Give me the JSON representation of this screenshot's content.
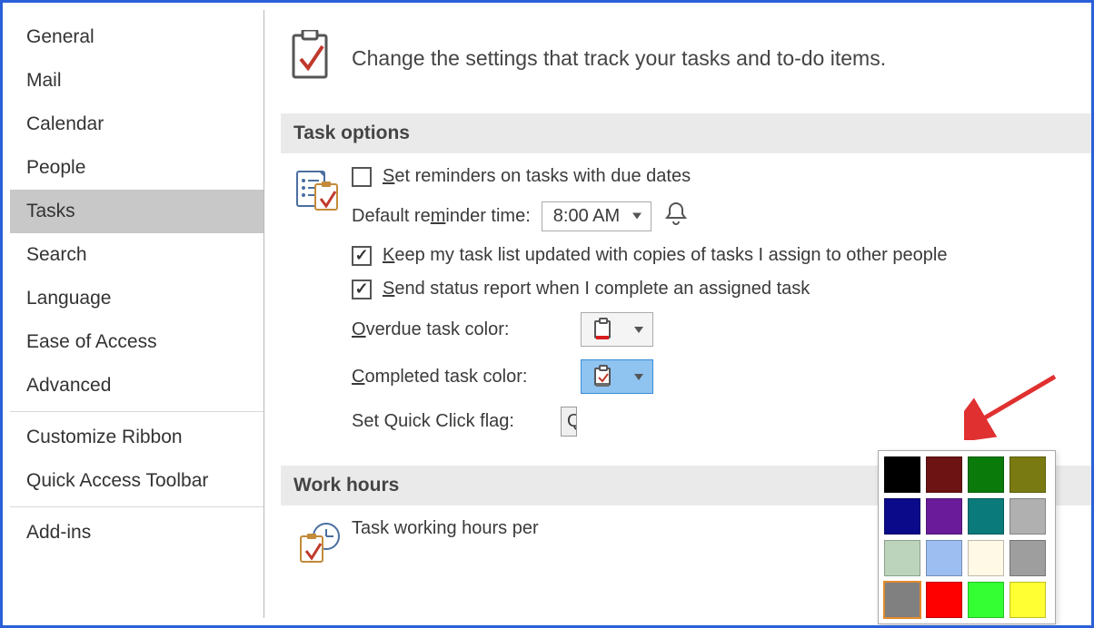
{
  "sidebar": {
    "items": [
      {
        "label": "General"
      },
      {
        "label": "Mail"
      },
      {
        "label": "Calendar"
      },
      {
        "label": "People"
      },
      {
        "label": "Tasks"
      },
      {
        "label": "Search"
      },
      {
        "label": "Language"
      },
      {
        "label": "Ease of Access"
      },
      {
        "label": "Advanced"
      },
      {
        "label": "Customize Ribbon"
      },
      {
        "label": "Quick Access Toolbar"
      },
      {
        "label": "Add-ins"
      }
    ],
    "selected_index": 4,
    "separators_after": [
      8,
      10
    ]
  },
  "header": {
    "description": "Change the settings that track your tasks and to-do items."
  },
  "sections": {
    "task_options": {
      "title": "Task options",
      "set_reminders": {
        "checked": false,
        "prefix": "S",
        "rest": "et reminders on tasks with due dates"
      },
      "default_reminder_label_prefix": "Default re",
      "default_reminder_label_u": "m",
      "default_reminder_label_rest": "inder time:",
      "default_reminder_value": "8:00 AM",
      "keep_updated": {
        "checked": true,
        "u": "K",
        "rest": "eep my task list updated with copies of tasks I assign to other people"
      },
      "send_status": {
        "checked": true,
        "u": "S",
        "rest": "end status report when I complete an assigned task"
      },
      "overdue_label_u": "O",
      "overdue_label_rest": "verdue task color:",
      "overdue_color": "#d81e1e",
      "completed_label_u": "C",
      "completed_label_rest": "ompleted task color:",
      "completed_color": "#6b6b6b",
      "quick_click_label": "Set Quick Click flag:",
      "quick_click_btn": "Quick Click..."
    },
    "work_hours": {
      "title": "Work hours",
      "row_label": "Task working hours per "
    }
  },
  "palette": {
    "colors": [
      "#000000",
      "#6d1313",
      "#0a7a0a",
      "#7a7a12",
      "#0a0a8a",
      "#6a1b9a",
      "#0a7a7a",
      "#b0b0b0",
      "#bcd4bc",
      "#9cbef0",
      "#fff9e6",
      "#9e9e9e",
      "#808080",
      "#ff0000",
      "#33ff33",
      "#ffff33"
    ],
    "selected_index": 12
  }
}
